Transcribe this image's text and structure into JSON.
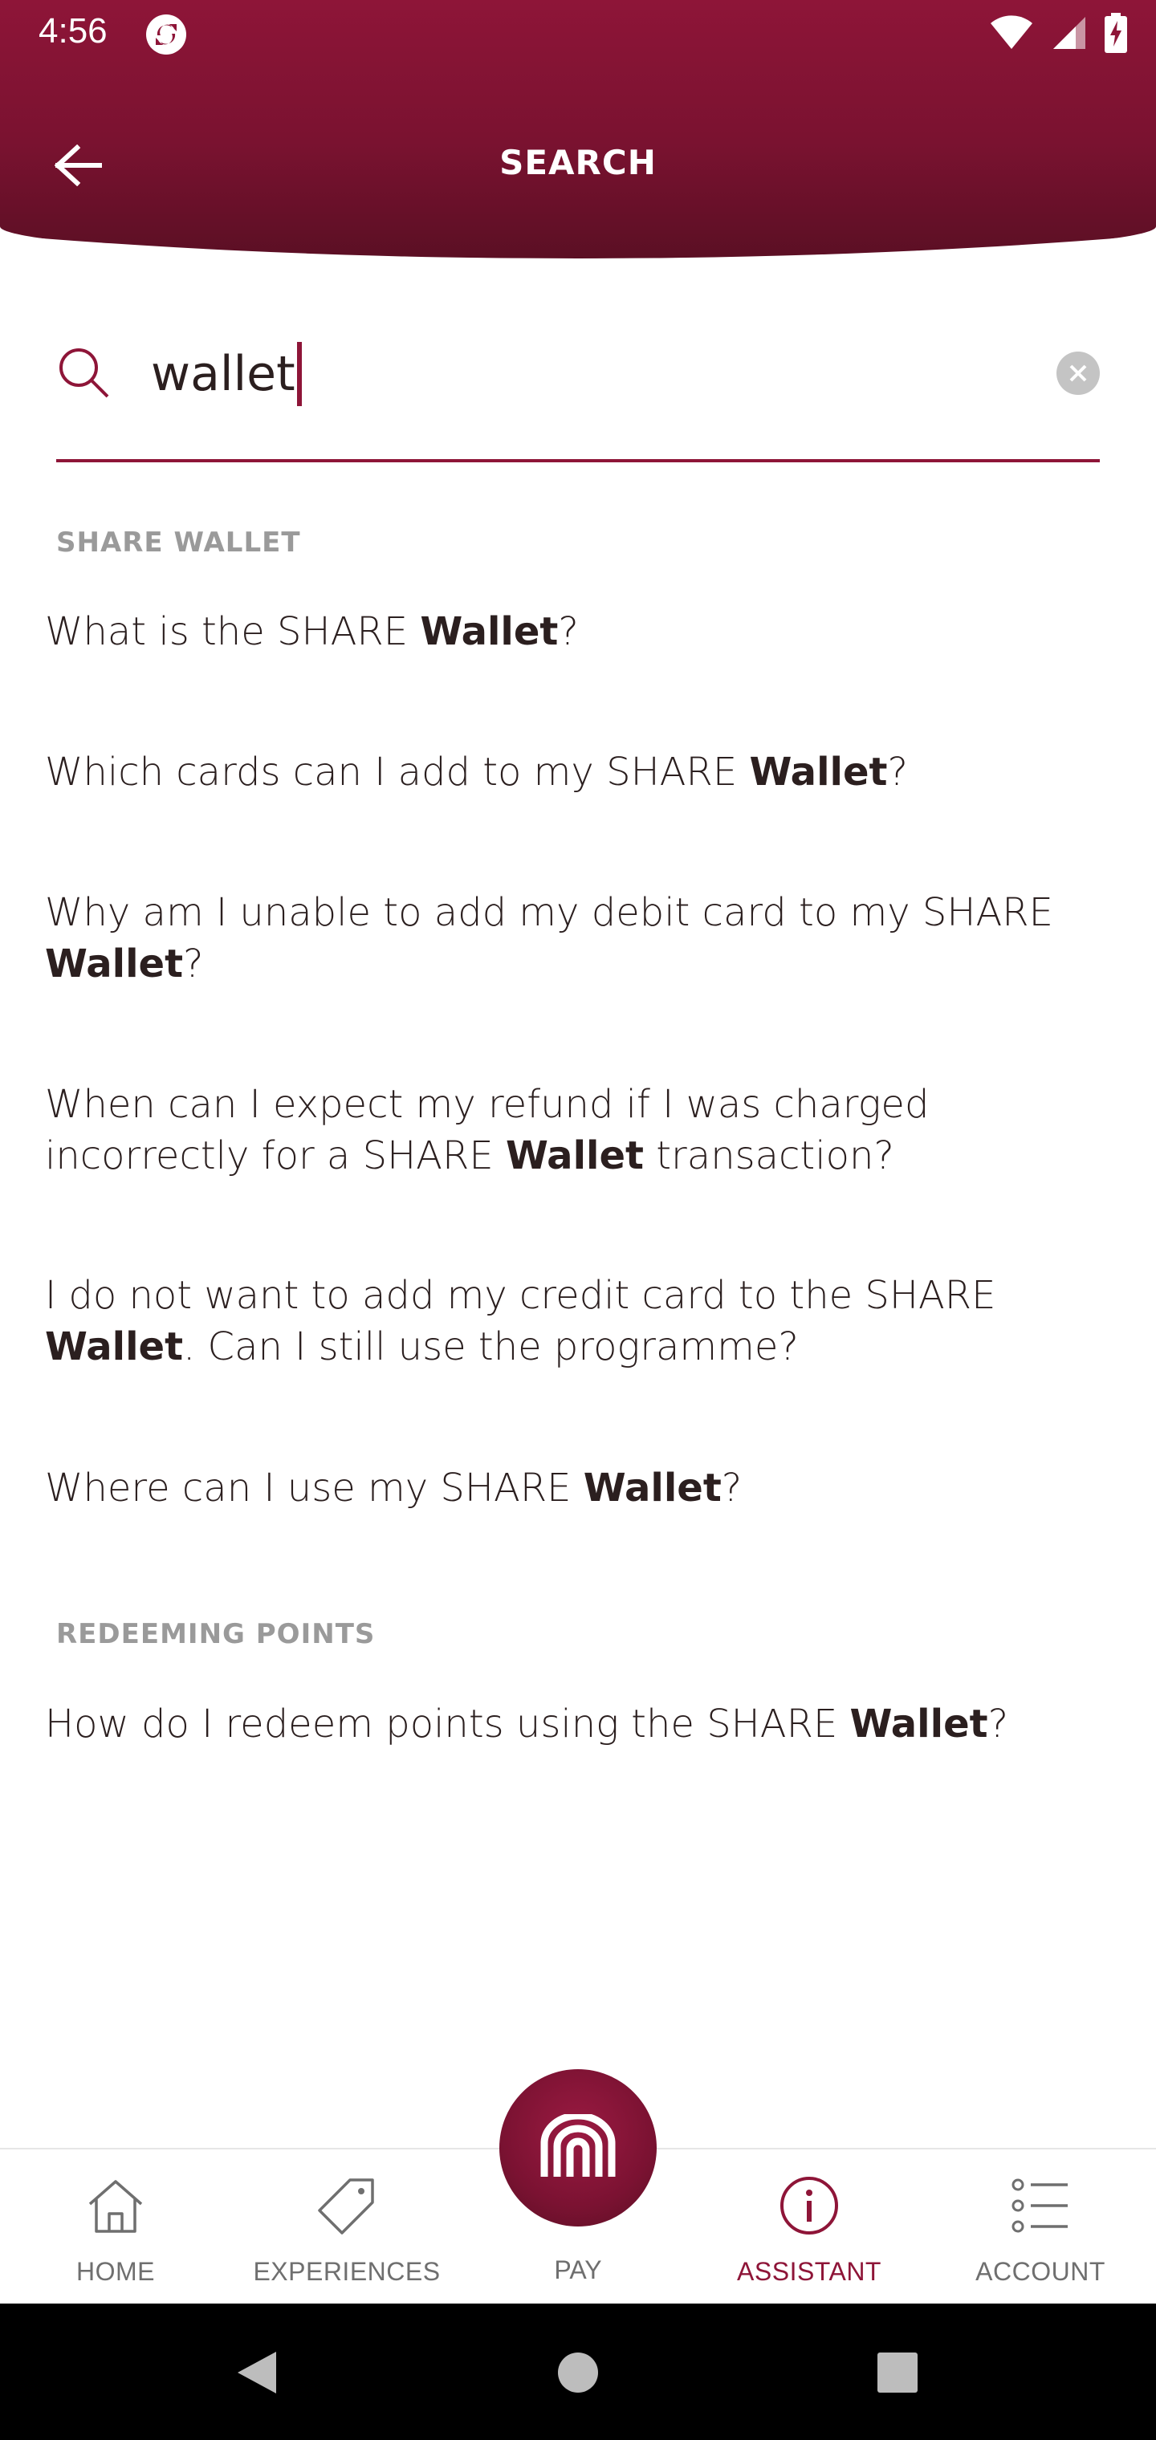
{
  "status_bar": {
    "time": "4:56",
    "icons": [
      "sync-icon",
      "wifi-icon",
      "signal-icon",
      "battery-charging-icon"
    ]
  },
  "header": {
    "title": "SEARCH",
    "back_icon": "arrow-left-icon",
    "gradient_color": "#8e1538"
  },
  "search": {
    "value": "wallet",
    "search_icon": "search-icon",
    "clear_icon": "clear-icon"
  },
  "sections": [
    {
      "title": "SHARE WALLET",
      "results": [
        {
          "before": "What is the SHARE ",
          "bold": "Wallet",
          "after": "?"
        },
        {
          "before": "Which cards can I add to my SHARE ",
          "bold": "Wallet",
          "after": "?"
        },
        {
          "before": "Why am I unable to add my debit card to my SHARE ",
          "bold": "Wallet",
          "after": "?"
        },
        {
          "before": "When can I expect my refund if I was charged incorrectly for a SHARE ",
          "bold": "Wallet",
          "after": " transaction?"
        },
        {
          "before": "I do not want to add my credit card to the SHARE ",
          "bold": "Wallet",
          "after": ". Can I still use the programme?"
        },
        {
          "before": "Where can I use my SHARE ",
          "bold": "Wallet",
          "after": "?"
        }
      ]
    },
    {
      "title": "REDEEMING POINTS",
      "results": [
        {
          "before": "How do I redeem points using the SHARE ",
          "bold": "Wallet",
          "after": "?"
        }
      ]
    }
  ],
  "bottom_nav": {
    "items": [
      {
        "label": "HOME",
        "icon": "home-icon",
        "active": false
      },
      {
        "label": "EXPERIENCES",
        "icon": "tag-icon",
        "active": false
      },
      {
        "label": "PAY",
        "icon": "pay-logo-icon",
        "active": false
      },
      {
        "label": "ASSISTANT",
        "icon": "info-icon",
        "active": true
      },
      {
        "label": "ACCOUNT",
        "icon": "list-icon",
        "active": false
      }
    ],
    "active_color": "#8e1538",
    "inactive_color": "#6f6f6f"
  },
  "system_nav": {
    "icons": [
      "back-triangle-icon",
      "home-circle-icon",
      "recents-square-icon"
    ]
  }
}
